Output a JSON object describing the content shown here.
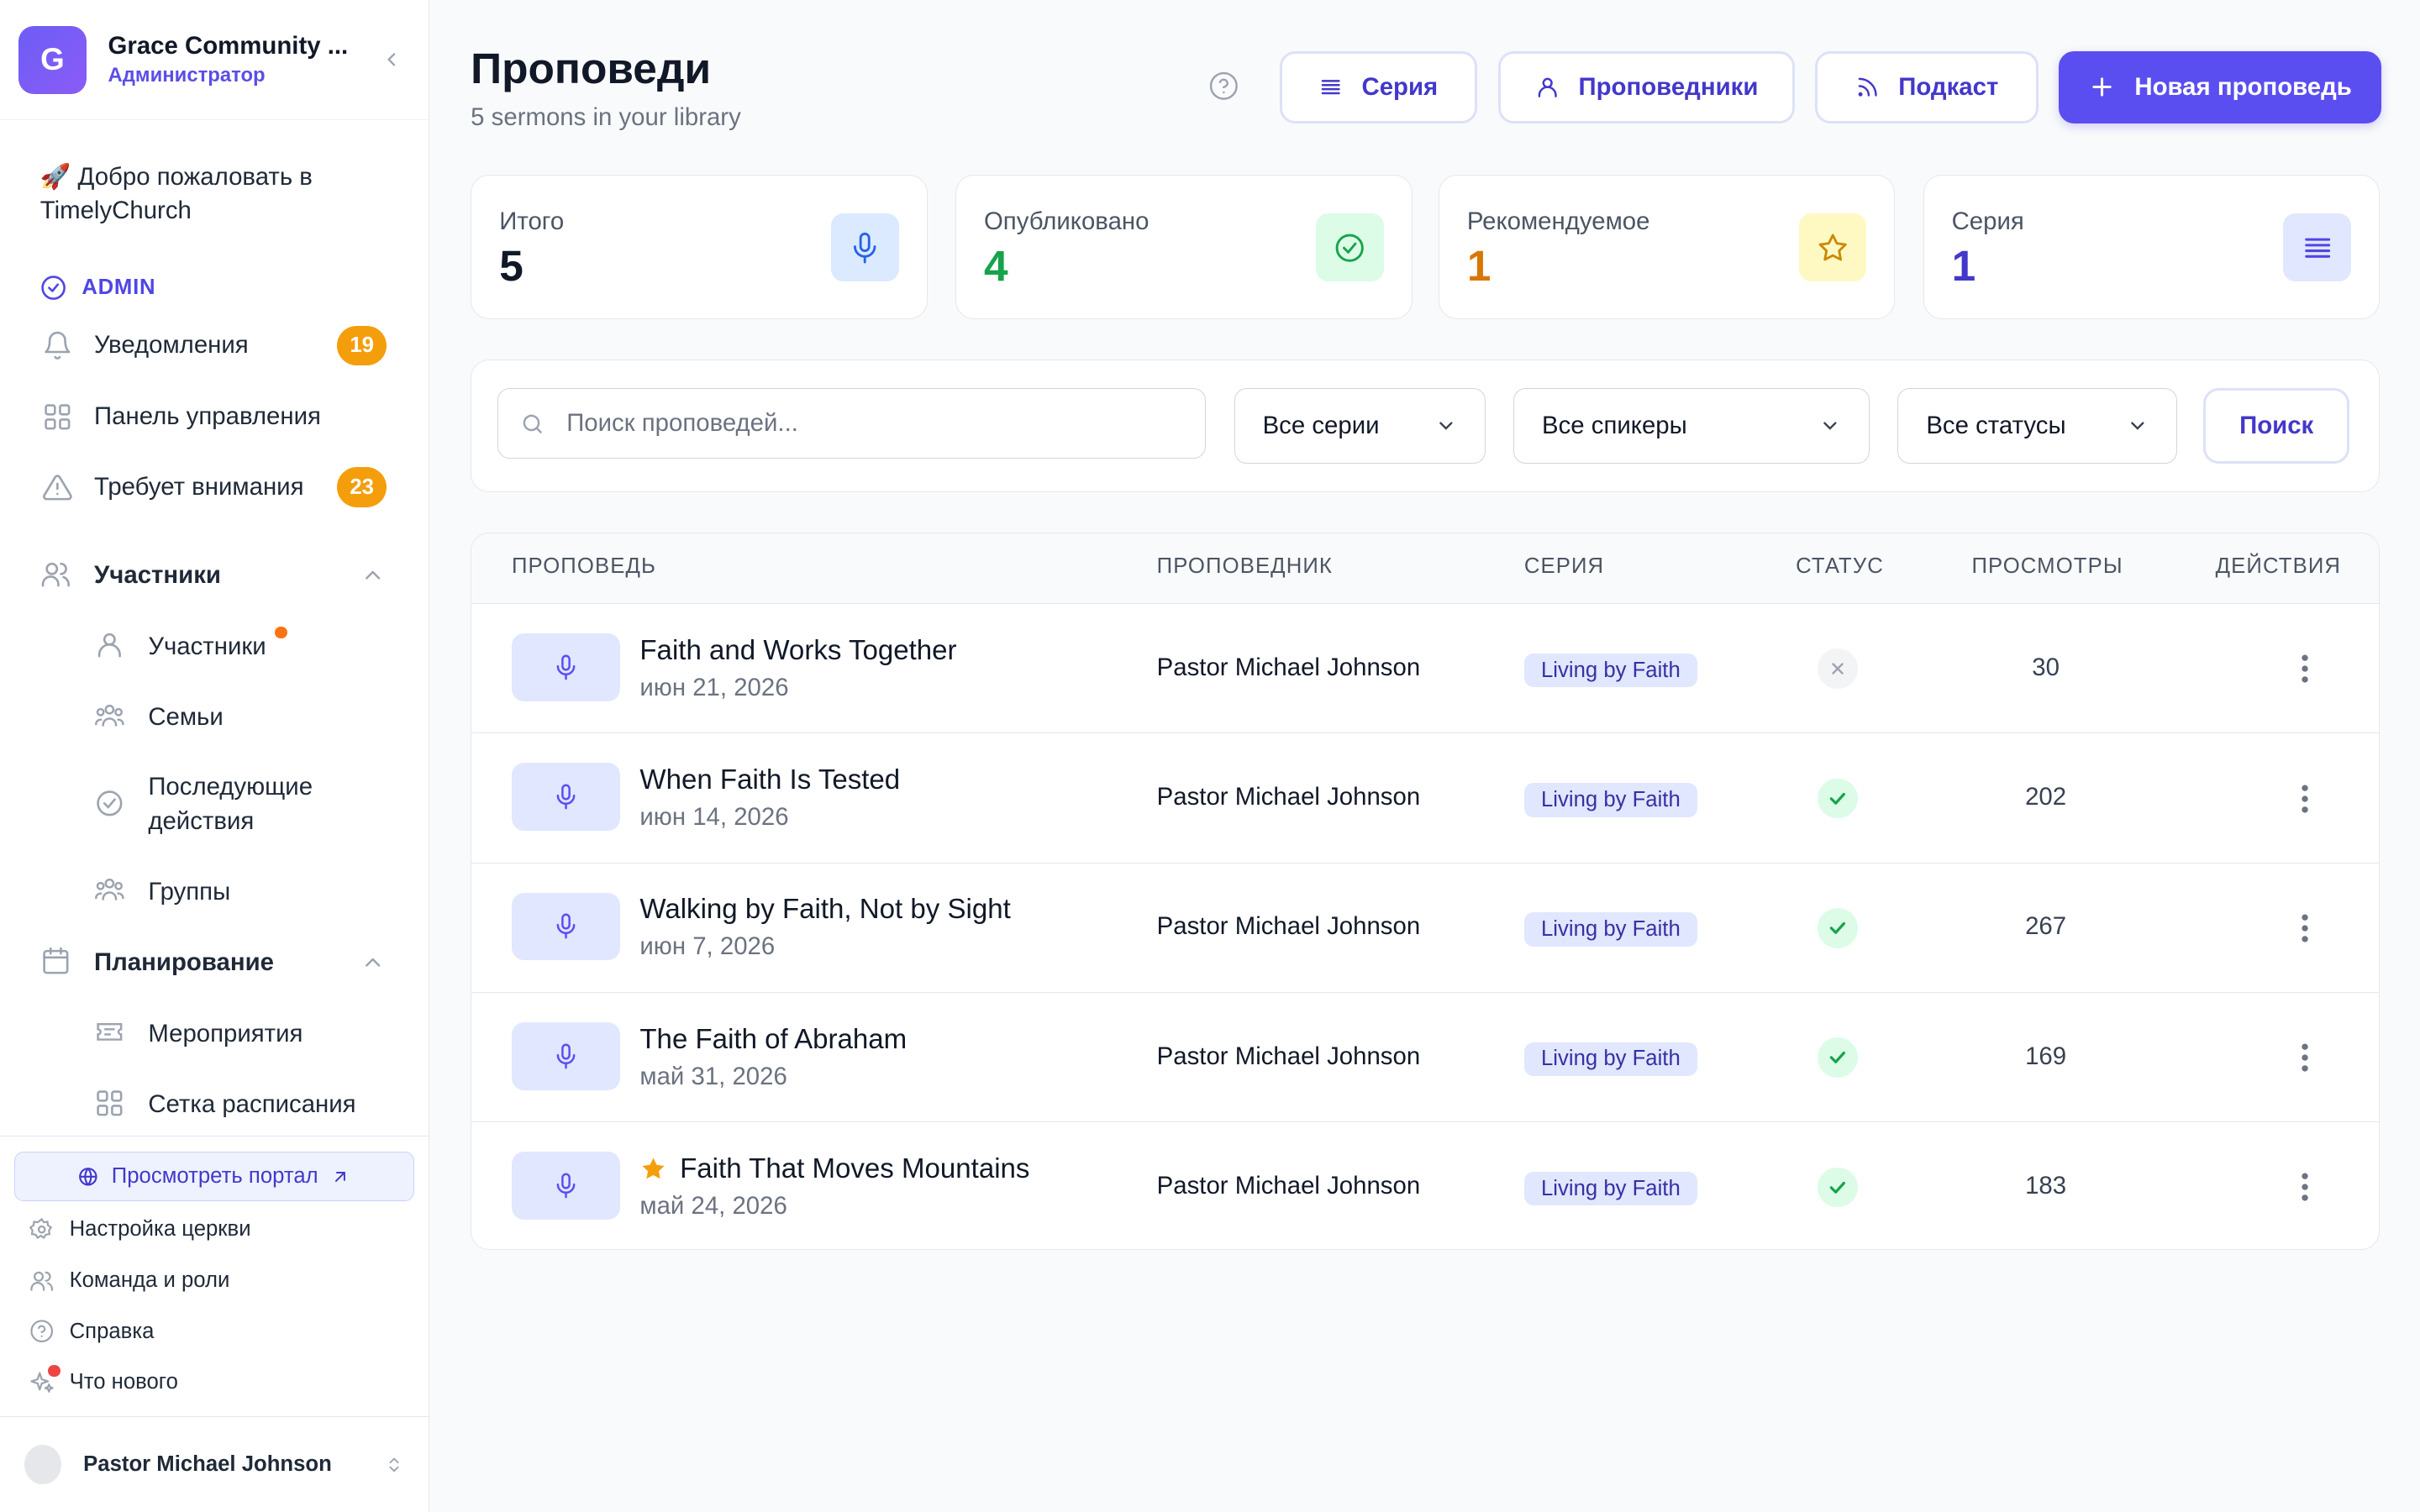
{
  "sidebar": {
    "org_initial": "G",
    "org_name": "Grace Community ...",
    "org_role": "Администратор",
    "welcome": "🚀 Добро пожаловать в TimelyChurch",
    "admin_label": "ADMIN",
    "items": [
      {
        "label": "Уведомления",
        "badge": "19",
        "icon": "bell-icon"
      },
      {
        "label": "Панель управления",
        "icon": "grid-icon"
      },
      {
        "label": "Требует внимания",
        "badge": "23",
        "icon": "alert-triangle-icon"
      }
    ],
    "members_section": {
      "label": "Участники",
      "items": [
        "Участники",
        "Семьи",
        "Последующие действия",
        "Группы"
      ]
    },
    "planning_section": {
      "label": "Планирование",
      "items": [
        "Мероприятия",
        "Сетка расписания"
      ]
    },
    "portal_button": "Просмотреть портал",
    "bottom_items": [
      "Настройка церкви",
      "Команда и роли",
      "Справка",
      "Что нового"
    ],
    "user_name": "Pastor Michael Johnson"
  },
  "header": {
    "title": "Проповеди",
    "subtitle": "5 sermons in your library",
    "btn_series": "Серия",
    "btn_preachers": "Проповедники",
    "btn_podcast": "Подкаст",
    "btn_new": "Новая проповедь"
  },
  "stats": [
    {
      "label": "Итого",
      "value": "5",
      "color": "#111827",
      "icon": "microphone-icon"
    },
    {
      "label": "Опубликовано",
      "value": "4",
      "color": "#16a34a",
      "icon": "check-circle-icon"
    },
    {
      "label": "Рекомендуемое",
      "value": "1",
      "color": "#d97706",
      "icon": "star-icon"
    },
    {
      "label": "Серия",
      "value": "1",
      "color": "#4338ca",
      "icon": "list-icon"
    }
  ],
  "filters": {
    "search_placeholder": "Поиск проповедей...",
    "series_value": "Все серии",
    "speakers_value": "Все спикеры",
    "status_value": "Все статусы",
    "search_button": "Поиск"
  },
  "table": {
    "headers": [
      "ПРОПОВЕДЬ",
      "ПРОПОВЕДНИК",
      "СЕРИЯ",
      "СТАТУС",
      "ПРОСМОТРЫ",
      "ДЕЙСТВИЯ"
    ],
    "rows": [
      {
        "title": "Faith and Works Together",
        "date": "июн 21, 2026",
        "preacher": "Pastor Michael Johnson",
        "series": "Living by Faith",
        "status": "unpublished",
        "views": "30",
        "featured": false
      },
      {
        "title": "When Faith Is Tested",
        "date": "июн 14, 2026",
        "preacher": "Pastor Michael Johnson",
        "series": "Living by Faith",
        "status": "published",
        "views": "202",
        "featured": false
      },
      {
        "title": "Walking by Faith, Not by Sight",
        "date": "июн 7, 2026",
        "preacher": "Pastor Michael Johnson",
        "series": "Living by Faith",
        "status": "published",
        "views": "267",
        "featured": false
      },
      {
        "title": "The Faith of Abraham",
        "date": "май 31, 2026",
        "preacher": "Pastor Michael Johnson",
        "series": "Living by Faith",
        "status": "published",
        "views": "169",
        "featured": false
      },
      {
        "title": "Faith That Moves Mountains",
        "date": "май 24, 2026",
        "preacher": "Pastor Michael Johnson",
        "series": "Living by Faith",
        "status": "published",
        "views": "183",
        "featured": true
      }
    ]
  },
  "colors": {
    "accent": "#5b4ef0",
    "published": "#16a34a",
    "featured": "#f59e0b",
    "badge": "#f59e0b"
  }
}
